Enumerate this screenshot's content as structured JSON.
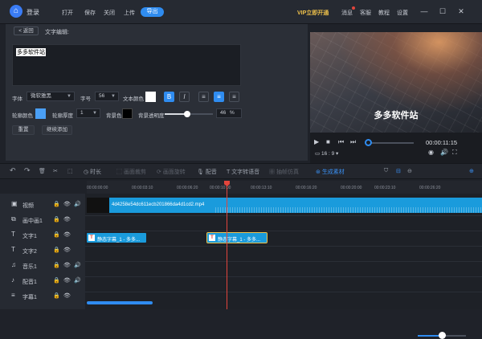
{
  "topbar": {
    "logo_glyph": "⌂",
    "login": "登录",
    "menu": [
      "打开",
      "保存",
      "关闭",
      "上传"
    ],
    "export": "导出",
    "vip": "VIP立即开通",
    "right_menu": [
      "消息",
      "客服",
      "教程",
      "设置"
    ],
    "window": [
      "—",
      "☐",
      "✕"
    ]
  },
  "editor": {
    "back": "< 返回",
    "title": "文字编辑:",
    "text_value": "多多软件站",
    "font_label": "字体",
    "font_value": "微软雅黑",
    "size_label": "字号",
    "size_value": "56",
    "text_color_label": "文本颜色",
    "text_color": "#ffffff",
    "bold": "B",
    "italic": "I",
    "align": [
      "≡",
      "≡",
      "≡"
    ],
    "outline_color_label": "轮廓颜色",
    "outline_color": "#4a9ff5",
    "outline_width_label": "轮廓厚度",
    "outline_width_value": "1",
    "bg_color_label": "背景色",
    "bg_color": "#000000",
    "bg_opacity_label": "背景透明度",
    "bg_opacity_value": "46",
    "bg_opacity_unit": "%",
    "reset": "重置",
    "continue_add": "继续添加"
  },
  "preview": {
    "caption": "多多软件站",
    "time": "00:00:11:15",
    "ratio": "16 : 9",
    "controls": [
      "▶",
      "■",
      "⏮",
      "⏭"
    ],
    "progress_fraction": 0.05
  },
  "toolbar": {
    "undo": "↶",
    "redo": "↷",
    "items": [
      "时长",
      "画面裁剪",
      "画面旋转",
      "配音",
      "文字转语音",
      "抽帧仿真",
      "生成素材"
    ],
    "zoom_fraction": 0.5
  },
  "timeline": {
    "ticks": [
      "00:00:00:00",
      "00:00:03:10",
      "00:00:06:20",
      "00:00:10:00",
      "00:00:13:10",
      "00:00:16:20",
      "00:00:20:00",
      "00:00:23:10",
      "00:00:26:20"
    ],
    "tracks": [
      {
        "icon": "▣",
        "name": "视频"
      },
      {
        "icon": "⧉",
        "name": "画中画1"
      },
      {
        "icon": "T",
        "name": "文字1"
      },
      {
        "icon": "T",
        "name": "文字2"
      },
      {
        "icon": "♫",
        "name": "音乐1"
      },
      {
        "icon": "♪",
        "name": "配音1"
      },
      {
        "icon": "≡",
        "name": "字幕1"
      }
    ],
    "video_clip_name": "4d4258e54dc611ecb201866da4d1cd2.mp4",
    "subtitle_clips": [
      {
        "badge": "T",
        "name": "静态字幕_1 - 多多..."
      },
      {
        "badge": "T",
        "name": "静态字幕_1 - 多多..."
      }
    ],
    "track_controls": [
      "🔒",
      "👁",
      "🔊"
    ]
  }
}
